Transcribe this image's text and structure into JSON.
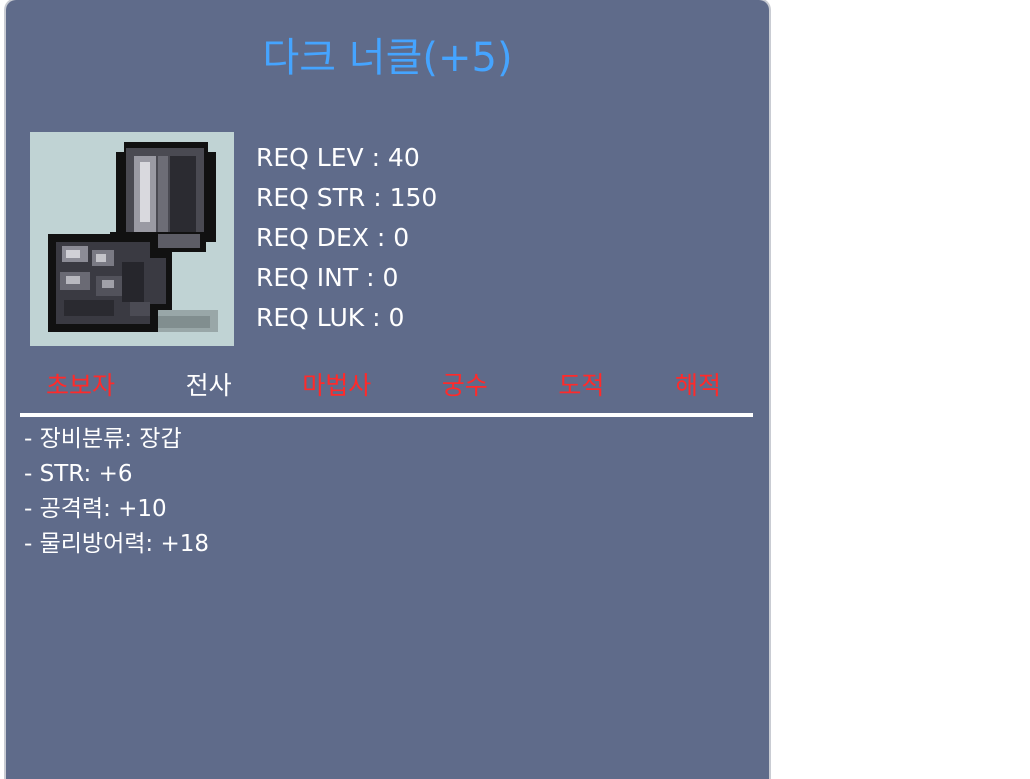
{
  "item": {
    "title": "다크 너클(+5)",
    "icon": "dark-knuckle-glove-icon"
  },
  "requirements": [
    {
      "text": "REQ LEV : 40"
    },
    {
      "text": "REQ STR : 150"
    },
    {
      "text": "REQ DEX : 0"
    },
    {
      "text": "REQ INT : 0"
    },
    {
      "text": "REQ LUK : 0"
    }
  ],
  "jobs": [
    {
      "label": "초보자",
      "allowed": false
    },
    {
      "label": "전사",
      "allowed": true
    },
    {
      "label": "마법사",
      "allowed": false
    },
    {
      "label": "궁수",
      "allowed": false
    },
    {
      "label": "도적",
      "allowed": false
    },
    {
      "label": "해적",
      "allowed": false
    }
  ],
  "stats": [
    {
      "text": "- 장비분류: 장갑"
    },
    {
      "text": "- STR: +6"
    },
    {
      "text": "- 공격력: +10"
    },
    {
      "text": "- 물리방어력: +18"
    }
  ],
  "colors": {
    "panel": "#5f6b8a",
    "title": "#45a4ff",
    "job_disabled": "#ff2a2a",
    "job_enabled": "#ffffff"
  }
}
